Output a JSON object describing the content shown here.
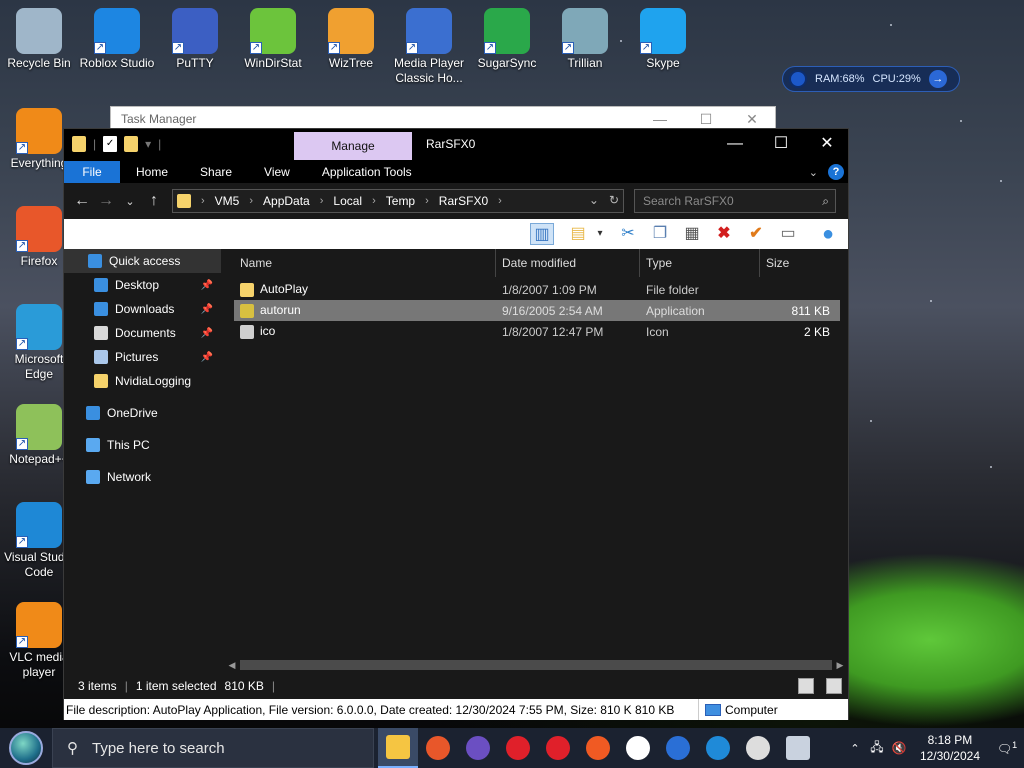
{
  "desktop": {
    "icons": [
      {
        "label": "Recycle Bin",
        "icon": "recycle-bin-icon",
        "color": "#9fb6c9"
      },
      {
        "label": "Roblox Studio",
        "icon": "roblox-studio-icon",
        "color": "#1d86e2"
      },
      {
        "label": "PuTTY",
        "icon": "putty-icon",
        "color": "#3c5fc3"
      },
      {
        "label": "WinDirStat",
        "icon": "windirstat-icon",
        "color": "#6cc43c"
      },
      {
        "label": "WizTree",
        "icon": "wiztree-icon",
        "color": "#f0a030"
      },
      {
        "label": "Media Player Classic Ho...",
        "icon": "media-player-classic-icon",
        "color": "#3b6fd0"
      },
      {
        "label": "SugarSync",
        "icon": "sugarsync-icon",
        "color": "#2aa84a"
      },
      {
        "label": "Trillian",
        "icon": "trillian-icon",
        "color": "#7fa8b8"
      },
      {
        "label": "Skype",
        "icon": "skype-icon",
        "color": "#1fa3ee"
      },
      {
        "label": "Everything",
        "icon": "everything-icon",
        "color": "#f08a18"
      },
      {
        "label": "Firefox",
        "icon": "firefox-icon",
        "color": "#e8572a"
      },
      {
        "label": "Microsoft Edge",
        "icon": "edge-icon",
        "color": "#2a9bd8"
      },
      {
        "label": "Notepad++",
        "icon": "notepad-plus-plus-icon",
        "color": "#8ec15a"
      },
      {
        "label": "Visual Studio Code",
        "icon": "vscode-icon",
        "color": "#1e88d6"
      },
      {
        "label": "VLC media player",
        "icon": "vlc-icon",
        "color": "#f08a18"
      }
    ]
  },
  "ram_widget": {
    "ram": "RAM:68%",
    "cpu": "CPU:29%"
  },
  "task_manager": {
    "title": "Task Manager"
  },
  "explorer": {
    "title": "RarSFX0",
    "contextual_tab": "Manage",
    "ribbon_tabs": [
      "File",
      "Home",
      "Share",
      "View",
      "Application Tools"
    ],
    "address_path": [
      "VM5",
      "AppData",
      "Local",
      "Temp",
      "RarSFX0"
    ],
    "search_placeholder": "Search RarSFX0",
    "nav": [
      {
        "label": "Quick access",
        "icon": "star-icon",
        "pinned": false
      },
      {
        "label": "Desktop",
        "icon": "desktop-icon",
        "pinned": true
      },
      {
        "label": "Downloads",
        "icon": "download-icon",
        "pinned": true
      },
      {
        "label": "Documents",
        "icon": "documents-icon",
        "pinned": true
      },
      {
        "label": "Pictures",
        "icon": "pictures-icon",
        "pinned": true
      },
      {
        "label": "NvidiaLogging",
        "icon": "folder-icon",
        "pinned": false
      },
      {
        "label": "OneDrive",
        "icon": "onedrive-icon",
        "pinned": false
      },
      {
        "label": "This PC",
        "icon": "this-pc-icon",
        "pinned": false
      },
      {
        "label": "Network",
        "icon": "network-icon",
        "pinned": false
      }
    ],
    "columns": [
      "Name",
      "Date modified",
      "Type",
      "Size"
    ],
    "files": [
      {
        "name": "AutoPlay",
        "date": "1/8/2007 1:09 PM",
        "type": "File folder",
        "size": "",
        "icon": "folder-icon"
      },
      {
        "name": "autorun",
        "date": "9/16/2005 2:54 AM",
        "type": "Application",
        "size": "811 KB",
        "icon": "application-icon"
      },
      {
        "name": "ico",
        "date": "1/8/2007 12:47 PM",
        "type": "Icon",
        "size": "2 KB",
        "icon": "icon-file-icon"
      }
    ],
    "status": {
      "items": "3 items",
      "selected": "1 item selected",
      "size": "810 KB"
    },
    "infobar": {
      "description": "File description: AutoPlay Application, File version: 6.0.0.0, Date created: 12/30/2024 7:55 PM, Size: 810 K 810 KB",
      "location": "Computer"
    }
  },
  "taskbar": {
    "search_placeholder": "Type here to search",
    "apps": [
      "file-explorer-icon",
      "firefox-icon",
      "brave-lock-icon",
      "opera-icon",
      "opera-icon",
      "brave-icon",
      "yandex-icon",
      "thunderbird-icon",
      "ccleaner-icon",
      "settings-icon",
      "network-share-icon"
    ],
    "time": "8:18 PM",
    "date": "12/30/2024",
    "notification_count": "1"
  }
}
